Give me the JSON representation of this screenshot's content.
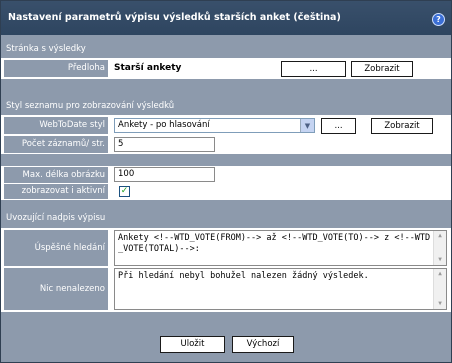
{
  "title": "Nastavení parametrů výpisu výsledků starších anket (čeština)",
  "help_icon": "help-icon",
  "sections": {
    "result_page": {
      "heading": "Stránka s výsledky",
      "template_label": "Předloha",
      "template_value": "Starší ankety",
      "browse_button": "...",
      "show_button": "Zobrazit"
    },
    "list_style": {
      "heading": "Styl seznamu pro zobrazování výsledků",
      "style_label": "WebToDate styl",
      "style_value": "Ankety - po hlasování",
      "browse_button": "...",
      "show_button": "Zobrazit",
      "count_label": "Počet záznamů/ str.",
      "count_value": "5"
    },
    "image": {
      "maxlen_label": "Max. délka obrázku",
      "maxlen_value": "100",
      "active_label": "zobrazovat i aktivní",
      "active_checked": true
    },
    "heading_text": {
      "heading": "Uvozující nadpis výpisu",
      "success_label": "Úspěšné hledání",
      "success_value": "Ankety <!--WTD_VOTE(FROM)--> až <!--WTD_VOTE(TO)--> z <!--WTD_VOTE(TOTAL)-->:",
      "notfound_label": "Nic nenalezeno",
      "notfound_value": "Při hledání nebyl bohužel nalezen žádný výsledek."
    }
  },
  "footer": {
    "save_button": "Uložit",
    "default_button": "Výchozí"
  }
}
